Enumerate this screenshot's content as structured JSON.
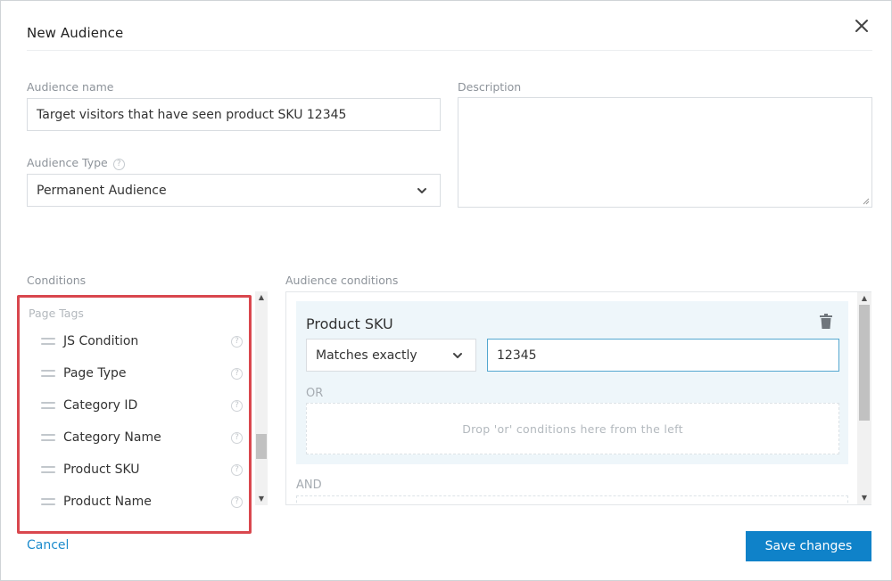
{
  "modal": {
    "title": "New Audience"
  },
  "form": {
    "audience_name_label": "Audience name",
    "audience_name_value": "Target visitors that have seen product SKU 12345",
    "description_label": "Description",
    "description_value": "",
    "audience_type_label": "Audience Type",
    "audience_type_value": "Permanent Audience",
    "help_glyph": "?"
  },
  "conditions": {
    "label": "Conditions",
    "heading": "Page Tags",
    "items": [
      {
        "label": "JS Condition"
      },
      {
        "label": "Page Type"
      },
      {
        "label": "Category ID"
      },
      {
        "label": "Category Name"
      },
      {
        "label": "Product SKU"
      },
      {
        "label": "Product Name"
      }
    ]
  },
  "audience_conditions": {
    "label": "Audience conditions",
    "rule": {
      "title": "Product SKU",
      "operator": "Matches exactly",
      "value": "12345"
    },
    "or_label": "OR",
    "or_drop_hint": "Drop 'or' conditions here from the left",
    "and_label": "AND"
  },
  "footer": {
    "cancel_label": "Cancel",
    "save_label": "Save changes"
  },
  "colors": {
    "accent": "#0f82c9",
    "highlight_border": "#d9474e",
    "rule_background": "#eef6fa"
  },
  "icons": {
    "close": "close-icon",
    "help": "help-icon",
    "chevron": "chevron-down-icon",
    "drag": "drag-handle-icon",
    "trash": "trash-icon"
  }
}
